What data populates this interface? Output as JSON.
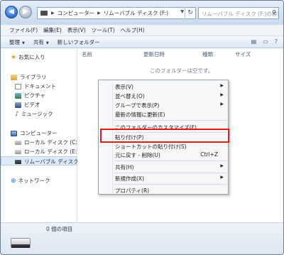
{
  "address": {
    "crumbs": [
      "コンピューター",
      "リムーバブル ディスク (F:)"
    ],
    "search_placeholder": "リムーバブル ディスク (F:)の検索"
  },
  "menubar": [
    "ファイル(F)",
    "編集(E)",
    "表示(V)",
    "ツール(T)",
    "ヘルプ(H)"
  ],
  "commandbar": {
    "organize": "整理",
    "share": "共有",
    "new_folder": "新しいフォルダー"
  },
  "nav": {
    "favorites": "お気に入り",
    "library": "ライブラリ",
    "documents": "ドキュメント",
    "pictures": "ピクチャ",
    "videos": "ビデオ",
    "music": "ミュージック",
    "computer": "コンピューター",
    "local_c": "ローカル ディスク (C:)",
    "local_e": "ローカル ディスク (E:)",
    "removable": "リムーバブル ディスク",
    "network": "ネットワーク"
  },
  "columns": [
    "名前",
    "更新日時",
    "種類",
    "サイズ"
  ],
  "empty_text": "このフォルダーは空です。",
  "context_menu": {
    "view": "表示(V)",
    "sort": "並べ替え(O)",
    "group": "グループで表示(P)",
    "refresh": "最新の情報に更新(E)",
    "customize": "このフォルダーのカスタマイズ(F)...",
    "paste": "貼り付け(P)",
    "paste_shortcut": "ショートカットの貼り付け(S)",
    "undo": "元に戻す - 削除(U)",
    "undo_shortcut": "Ctrl+Z",
    "share": "共有(H)",
    "new": "新規作成(X)",
    "properties": "プロパティ(R)"
  },
  "status": {
    "item_count": "0 個の項目"
  },
  "colors": {
    "highlight_border": "#e01818",
    "window_frame": "#c9d9ec"
  }
}
